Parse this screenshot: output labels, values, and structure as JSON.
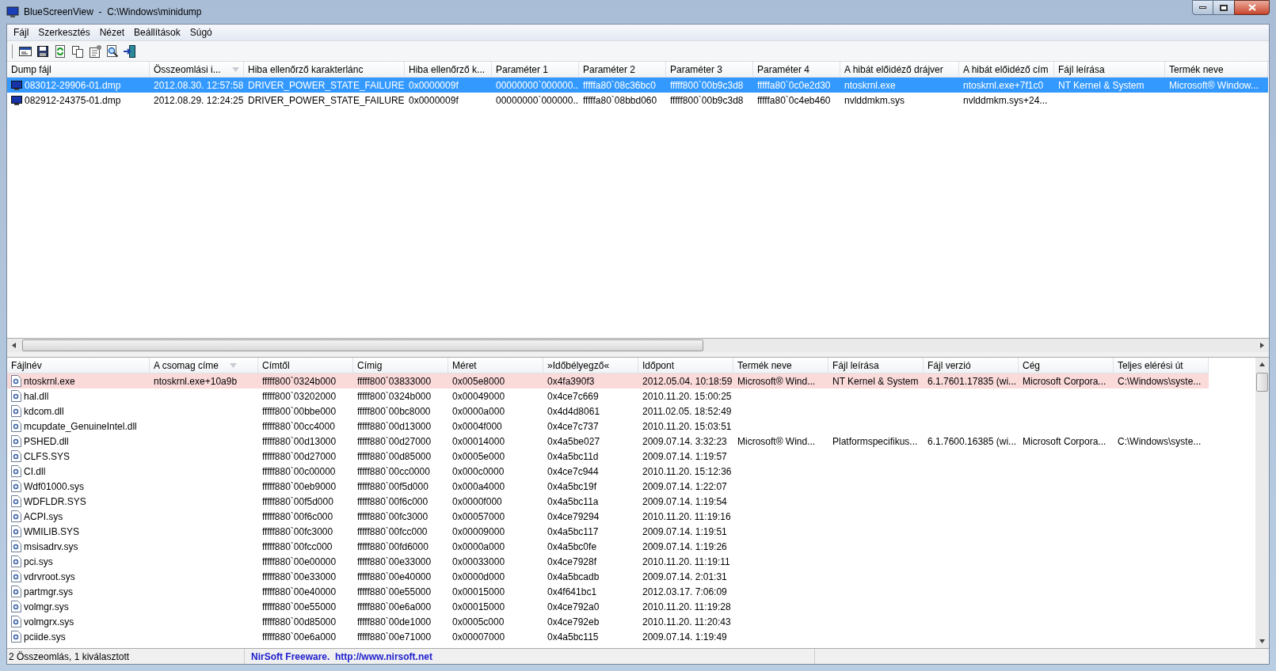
{
  "window": {
    "title": "BlueScreenView  -  C:\\Windows\\minidump"
  },
  "menu": [
    "Fájl",
    "Szerkesztés",
    "Nézet",
    "Beállítások",
    "Súgó"
  ],
  "upper_table": {
    "columns": [
      {
        "label": "Dump fájl",
        "sorted": false
      },
      {
        "label": "Összeomlási i...",
        "sorted": true
      },
      {
        "label": "Hiba ellenőrző karakterlánc",
        "sorted": false
      },
      {
        "label": "Hiba ellenőrző k...",
        "sorted": false
      },
      {
        "label": "Paraméter 1",
        "sorted": false
      },
      {
        "label": "Paraméter 2",
        "sorted": false
      },
      {
        "label": "Paraméter 3",
        "sorted": false
      },
      {
        "label": "Paraméter 4",
        "sorted": false
      },
      {
        "label": "A hibát előidéző drájver",
        "sorted": false
      },
      {
        "label": "A hibát előidéző cím",
        "sorted": false
      },
      {
        "label": "Fájl leírása",
        "sorted": false
      },
      {
        "label": "Termék neve",
        "sorted": false
      }
    ],
    "rows": [
      {
        "selected": true,
        "cells": [
          "083012-29906-01.dmp",
          "2012.08.30. 12:57:58",
          "DRIVER_POWER_STATE_FAILURE",
          "0x0000009f",
          "00000000`000000...",
          "fffffa80`08c36bc0",
          "fffff800`00b9c3d8",
          "fffffa80`0c0e2d30",
          "ntoskrnl.exe",
          "ntoskrnl.exe+7f1c0",
          "NT Kernel & System",
          "Microsoft® Window..."
        ]
      },
      {
        "selected": false,
        "cells": [
          "082912-24375-01.dmp",
          "2012.08.29. 12:24:25",
          "DRIVER_POWER_STATE_FAILURE",
          "0x0000009f",
          "00000000`000000...",
          "fffffa80`08bbd060",
          "fffff800`00b9c3d8",
          "fffffa80`0c4eb460",
          "nvlddmkm.sys",
          "nvlddmkm.sys+24...",
          null,
          null
        ]
      }
    ]
  },
  "lower_table": {
    "columns": [
      {
        "label": "Fájlnév",
        "sorted": false
      },
      {
        "label": "A csomag címe",
        "sorted": true
      },
      {
        "label": "Címtől",
        "sorted": false
      },
      {
        "label": "Címig",
        "sorted": false
      },
      {
        "label": "Méret",
        "sorted": false
      },
      {
        "label": "»Időbélyegző«",
        "sorted": false
      },
      {
        "label": "Időpont",
        "sorted": false
      },
      {
        "label": "Termék neve",
        "sorted": false
      },
      {
        "label": "Fájl leírása",
        "sorted": false
      },
      {
        "label": "Fájl verzió",
        "sorted": false
      },
      {
        "label": "Cég",
        "sorted": false
      },
      {
        "label": "Teljes elérési út",
        "sorted": false
      }
    ],
    "rows": [
      {
        "highlighted": true,
        "cells": [
          "ntoskrnl.exe",
          "ntoskrnl.exe+10a9b",
          "fffff800`0324b000",
          "fffff800`03833000",
          "0x005e8000",
          "0x4fa390f3",
          "2012.05.04. 10:18:59",
          "Microsoft® Wind...",
          "NT Kernel & System",
          "6.1.7601.17835 (wi...",
          "Microsoft Corpora...",
          "C:\\Windows\\syste..."
        ]
      },
      {
        "highlighted": false,
        "cells": [
          "hal.dll",
          null,
          "fffff800`03202000",
          "fffff800`0324b000",
          "0x00049000",
          "0x4ce7c669",
          "2010.11.20. 15:00:25",
          null,
          null,
          null,
          null,
          null
        ]
      },
      {
        "highlighted": false,
        "cells": [
          "kdcom.dll",
          null,
          "fffff800`00bbe000",
          "fffff800`00bc8000",
          "0x0000a000",
          "0x4d4d8061",
          "2011.02.05. 18:52:49",
          null,
          null,
          null,
          null,
          null
        ]
      },
      {
        "highlighted": false,
        "cells": [
          "mcupdate_GenuineIntel.dll",
          null,
          "fffff880`00cc4000",
          "fffff880`00d13000",
          "0x0004f000",
          "0x4ce7c737",
          "2010.11.20. 15:03:51",
          null,
          null,
          null,
          null,
          null
        ]
      },
      {
        "highlighted": false,
        "cells": [
          "PSHED.dll",
          null,
          "fffff880`00d13000",
          "fffff880`00d27000",
          "0x00014000",
          "0x4a5be027",
          "2009.07.14. 3:32:23",
          "Microsoft® Wind...",
          "Platformspecifikus...",
          "6.1.7600.16385 (wi...",
          "Microsoft Corpora...",
          "C:\\Windows\\syste..."
        ]
      },
      {
        "highlighted": false,
        "cells": [
          "CLFS.SYS",
          null,
          "fffff880`00d27000",
          "fffff880`00d85000",
          "0x0005e000",
          "0x4a5bc11d",
          "2009.07.14. 1:19:57",
          null,
          null,
          null,
          null,
          null
        ]
      },
      {
        "highlighted": false,
        "cells": [
          "CI.dll",
          null,
          "fffff880`00c00000",
          "fffff880`00cc0000",
          "0x000c0000",
          "0x4ce7c944",
          "2010.11.20. 15:12:36",
          null,
          null,
          null,
          null,
          null
        ]
      },
      {
        "highlighted": false,
        "cells": [
          "Wdf01000.sys",
          null,
          "fffff880`00eb9000",
          "fffff880`00f5d000",
          "0x000a4000",
          "0x4a5bc19f",
          "2009.07.14. 1:22:07",
          null,
          null,
          null,
          null,
          null
        ]
      },
      {
        "highlighted": false,
        "cells": [
          "WDFLDR.SYS",
          null,
          "fffff880`00f5d000",
          "fffff880`00f6c000",
          "0x0000f000",
          "0x4a5bc11a",
          "2009.07.14. 1:19:54",
          null,
          null,
          null,
          null,
          null
        ]
      },
      {
        "highlighted": false,
        "cells": [
          "ACPI.sys",
          null,
          "fffff880`00f6c000",
          "fffff880`00fc3000",
          "0x00057000",
          "0x4ce79294",
          "2010.11.20. 11:19:16",
          null,
          null,
          null,
          null,
          null
        ]
      },
      {
        "highlighted": false,
        "cells": [
          "WMILIB.SYS",
          null,
          "fffff880`00fc3000",
          "fffff880`00fcc000",
          "0x00009000",
          "0x4a5bc117",
          "2009.07.14. 1:19:51",
          null,
          null,
          null,
          null,
          null
        ]
      },
      {
        "highlighted": false,
        "cells": [
          "msisadrv.sys",
          null,
          "fffff880`00fcc000",
          "fffff880`00fd6000",
          "0x0000a000",
          "0x4a5bc0fe",
          "2009.07.14. 1:19:26",
          null,
          null,
          null,
          null,
          null
        ]
      },
      {
        "highlighted": false,
        "cells": [
          "pci.sys",
          null,
          "fffff880`00e00000",
          "fffff880`00e33000",
          "0x00033000",
          "0x4ce7928f",
          "2010.11.20. 11:19:11",
          null,
          null,
          null,
          null,
          null
        ]
      },
      {
        "highlighted": false,
        "cells": [
          "vdrvroot.sys",
          null,
          "fffff880`00e33000",
          "fffff880`00e40000",
          "0x0000d000",
          "0x4a5bcadb",
          "2009.07.14. 2:01:31",
          null,
          null,
          null,
          null,
          null
        ]
      },
      {
        "highlighted": false,
        "cells": [
          "partmgr.sys",
          null,
          "fffff880`00e40000",
          "fffff880`00e55000",
          "0x00015000",
          "0x4f641bc1",
          "2012.03.17. 7:06:09",
          null,
          null,
          null,
          null,
          null
        ]
      },
      {
        "highlighted": false,
        "cells": [
          "volmgr.sys",
          null,
          "fffff880`00e55000",
          "fffff880`00e6a000",
          "0x00015000",
          "0x4ce792a0",
          "2010.11.20. 11:19:28",
          null,
          null,
          null,
          null,
          null
        ]
      },
      {
        "highlighted": false,
        "cells": [
          "volmgrx.sys",
          null,
          "fffff880`00d85000",
          "fffff880`00de1000",
          "0x0005c000",
          "0x4ce792eb",
          "2010.11.20. 11:20:43",
          null,
          null,
          null,
          null,
          null
        ]
      },
      {
        "highlighted": false,
        "cells": [
          "pciide.sys",
          null,
          "fffff880`00e6a000",
          "fffff880`00e71000",
          "0x00007000",
          "0x4a5bc115",
          "2009.07.14. 1:19:49",
          null,
          null,
          null,
          null,
          null
        ]
      }
    ]
  },
  "status_bar": {
    "text": "2 Összeomlás, 1 kiválasztott",
    "link": "NirSoft Freeware.  http://www.nirsoft.net"
  }
}
